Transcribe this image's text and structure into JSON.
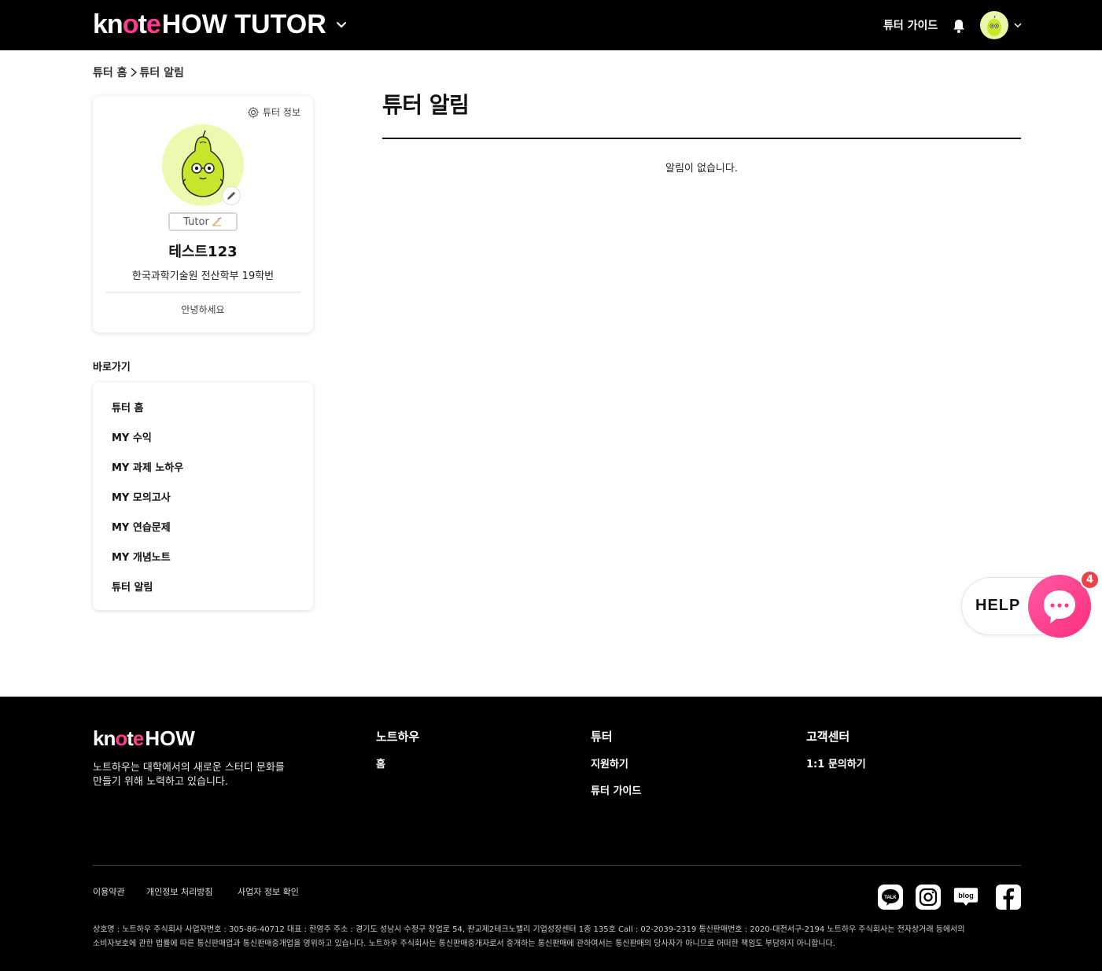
{
  "header": {
    "logo_knote": "knote",
    "logo_how": "HOW TUTOR",
    "guide_label": "튜터 가이드"
  },
  "breadcrumb": {
    "home": "튜터 홈",
    "current": "튜터 알림"
  },
  "profile": {
    "info_link": "튜터 정보",
    "badge": "Tutor",
    "name": "테스트123",
    "school": "한국과학기술원 전산학부 19학번",
    "intro": "안녕하세요"
  },
  "shortcuts": {
    "title": "바로가기",
    "items": [
      {
        "label": "튜터 홈"
      },
      {
        "label": "MY 수익"
      },
      {
        "label": "MY 과제 노하우"
      },
      {
        "label": "MY 모의고사"
      },
      {
        "label": "MY 연습문제"
      },
      {
        "label": "MY 개념노트"
      },
      {
        "label": "튜터 알림"
      }
    ]
  },
  "main": {
    "title": "튜터 알림",
    "empty_message": "알림이 없습니다."
  },
  "help": {
    "label": "HELP",
    "count": "4"
  },
  "footer": {
    "logo_knote": "knote",
    "logo_how": "HOW",
    "description_line1": "노트하우는 대학에서의 새로운 스터디 문화를",
    "description_line2": "만들기 위해 노력하고 있습니다.",
    "columns": [
      {
        "title": "노트하우",
        "links": [
          "홈"
        ]
      },
      {
        "title": "튜터",
        "links": [
          "지원하기",
          "튜터 가이드"
        ]
      },
      {
        "title": "고객센터",
        "links": [
          "1:1 문의하기"
        ]
      }
    ],
    "policies": [
      "이용약관",
      "개인정보 처리방침",
      "사업자 정보 확인"
    ],
    "social": [
      "kakaotalk-icon",
      "instagram-icon",
      "blog-icon",
      "facebook-icon"
    ],
    "business_line1": "상호명 : 노트하우 주식회사 사업자번호 : 305-86-40712 대표 : 한영주 주소 : 경기도 성남시 수정구 창업로 54, 판교제2테크노밸리 기업성장센터 1층 135호 Call : 02-2039-2319 통신판매번호 : 2020-대전서구-2194 노트하우 주식회사는 전자상거래 등에서의",
    "business_line2": "소비자보호에 관한 법률에 따른 통신판매업과 통신판매중개업을 영위하고 있습니다. 노트하우 주식회사는 통신판매중개자로서 중개하는 통신판매에 관하여서는 통신판매의 당사자가 아니므로 어떠한 책임도 부담하지 아니합니다."
  },
  "colors": {
    "brand_pink": "#ff3d8c",
    "header_bg": "#000000",
    "help_badge": "#e8424a"
  }
}
